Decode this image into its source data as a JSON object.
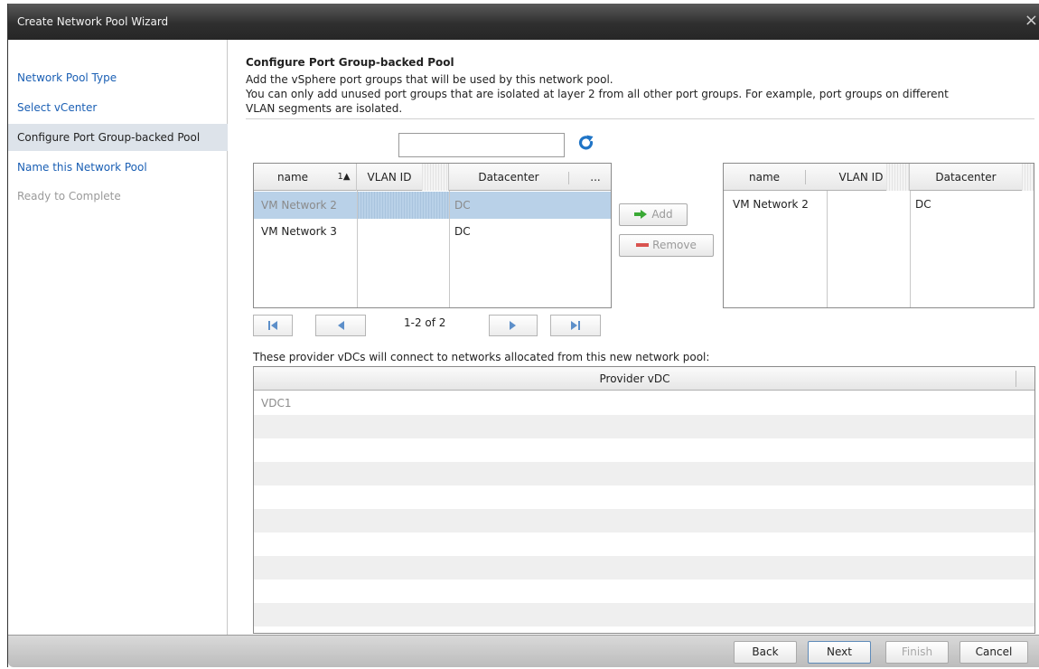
{
  "window": {
    "title": "Create Network Pool Wizard",
    "close_glyph": "×"
  },
  "steps": [
    {
      "label": "Network Pool Type",
      "state": "link"
    },
    {
      "label": "Select vCenter",
      "state": "link"
    },
    {
      "label": "Configure Port Group-backed Pool",
      "state": "active"
    },
    {
      "label": "Name this Network Pool",
      "state": "link"
    },
    {
      "label": "Ready to Complete",
      "state": "disabled"
    }
  ],
  "main": {
    "heading": "Configure Port Group-backed Pool",
    "desc1": "Add the vSphere port groups that will be used by this network pool.",
    "desc2": "You can only add unused port groups that are isolated at layer 2 from all other port groups. For example, port groups on different",
    "desc3": "VLAN segments are isolated."
  },
  "search": {
    "value": "",
    "placeholder": ""
  },
  "available": {
    "headers": {
      "name": "name",
      "sort": "1▲",
      "vlan": "VLAN ID",
      "datacenter": "Datacenter",
      "more": "..."
    },
    "rows": [
      {
        "name": "VM Network 2",
        "vlan": "",
        "datacenter": "DC",
        "selected": true
      },
      {
        "name": "VM Network 3",
        "vlan": "",
        "datacenter": "DC",
        "selected": false
      }
    ],
    "pager_text": "1-2 of 2"
  },
  "actions": {
    "add": "Add",
    "remove": "Remove"
  },
  "selected": {
    "headers": {
      "name": "name",
      "vlan": "VLAN ID",
      "datacenter": "Datacenter"
    },
    "rows": [
      {
        "name": "VM Network 2",
        "vlan": "",
        "datacenter": "DC"
      }
    ]
  },
  "provider": {
    "note": "These provider vDCs will connect to networks allocated from this new network pool:",
    "header": "Provider vDC",
    "rows": [
      "VDC1"
    ]
  },
  "footer": {
    "back": "Back",
    "next": "Next",
    "finish": "Finish",
    "cancel": "Cancel"
  },
  "colors": {
    "link": "#1a5fb4",
    "active_step_bg": "#dde3ea",
    "selection": "#b9d1e8",
    "add_arrow": "#3aa935",
    "remove_bar": "#d9534f",
    "refresh": "#1f74c6"
  }
}
